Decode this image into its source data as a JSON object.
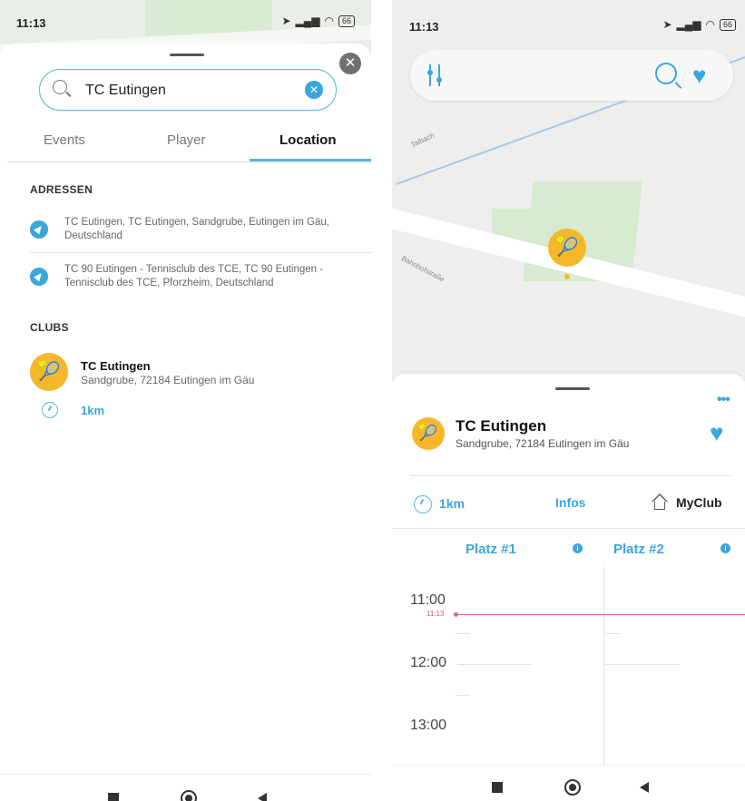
{
  "status_bar": {
    "time": "11:13",
    "battery": "66"
  },
  "search_screen": {
    "close_icon": "close-icon",
    "search": {
      "query": "TC Eutingen",
      "clear_icon": "clear-icon"
    },
    "tabs": [
      {
        "label": "Events",
        "active": false
      },
      {
        "label": "Player",
        "active": false
      },
      {
        "label": "Location",
        "active": true
      }
    ],
    "sections": {
      "addresses": "ADRESSEN",
      "clubs": "CLUBS"
    },
    "addresses": [
      {
        "text": "TC Eutingen, TC Eutingen, Sandgrube, Eutingen im Gäu, Deutschland"
      },
      {
        "text": "TC 90 Eutingen - Tennisclub des TCE, TC 90 Eutingen - Tennisclub des TCE, Pforzheim, Deutschland"
      }
    ],
    "clubs": [
      {
        "name": "TC Eutingen",
        "address": "Sandgrube, 72184 Eutingen im Gäu",
        "distance": "1km"
      }
    ]
  },
  "club_screen": {
    "map_labels": {
      "street_1": "Talbach",
      "street_2": "Bahnhofstraße"
    },
    "club": {
      "name": "TC Eutingen",
      "address": "Sandgrube, 72184 Eutingen im Gäu",
      "distance": "1km",
      "favorite": true
    },
    "actions": {
      "infos": "Infos",
      "myclub": "MyClub"
    },
    "courts": [
      {
        "label": "Platz #1"
      },
      {
        "label": "Platz #2"
      }
    ],
    "schedule": {
      "hours": [
        "11:00",
        "12:00",
        "13:00"
      ],
      "now": "11:13"
    }
  },
  "colors": {
    "accent": "#3aa6dc",
    "club": "#f6b82a",
    "now_line": "#e46a6a"
  }
}
